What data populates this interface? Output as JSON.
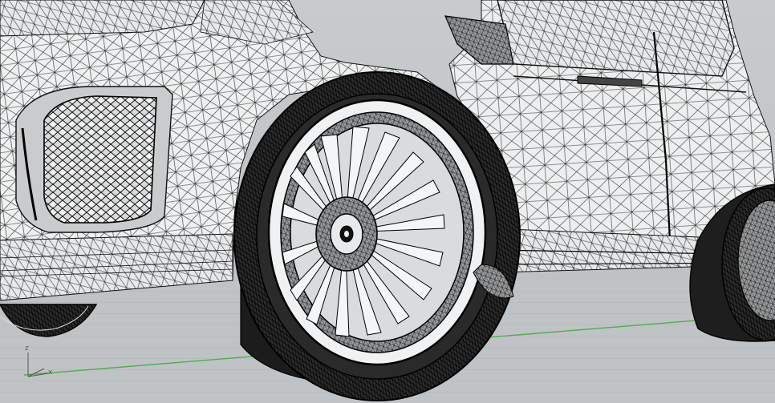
{
  "viewport": {
    "mode": "wireframe-3d-render",
    "background_color": "#c3c6c8",
    "wire_color": "#1a1a1a",
    "ground_axis_color": "#4caf50"
  },
  "axis_gizmo": {
    "z_label": "z",
    "x_label": "x"
  },
  "icons": {
    "axis_gizmo": "xyz-axis-icon"
  }
}
